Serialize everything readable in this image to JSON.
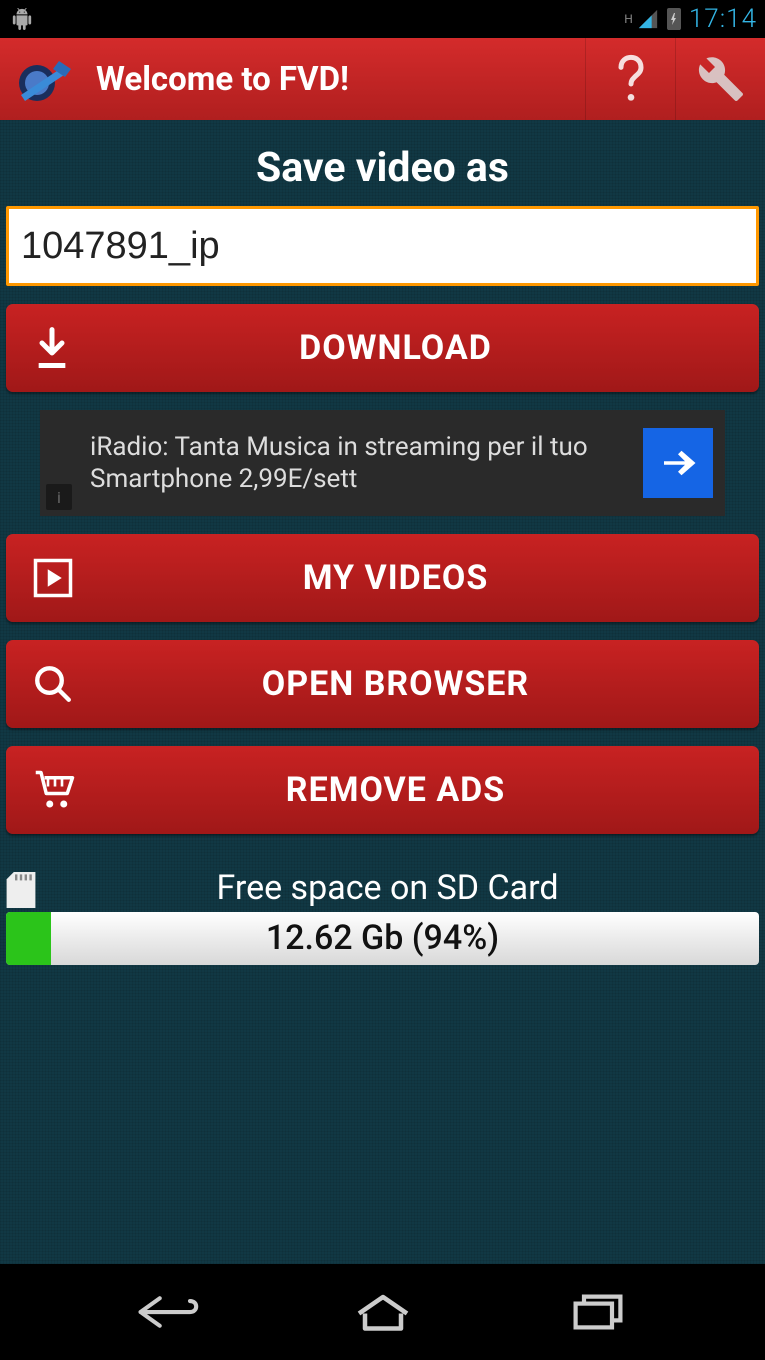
{
  "status": {
    "time": "17:14",
    "h_indicator": "H"
  },
  "appbar": {
    "title": "Welcome to FVD!"
  },
  "main": {
    "save_as_label": "Save video as",
    "filename_value": "1047891_ip",
    "buttons": {
      "download": "DOWNLOAD",
      "my_videos": "MY VIDEOS",
      "open_browser": "OPEN BROWSER",
      "remove_ads": "REMOVE ADS"
    },
    "ad": {
      "text": "iRadio: Tanta Musica in streaming per il tuo Smartphone 2,99E/sett",
      "info": "i"
    },
    "storage": {
      "label": "Free space on SD Card",
      "value": "12.62 Gb (94%)",
      "used_percent": 6
    }
  }
}
